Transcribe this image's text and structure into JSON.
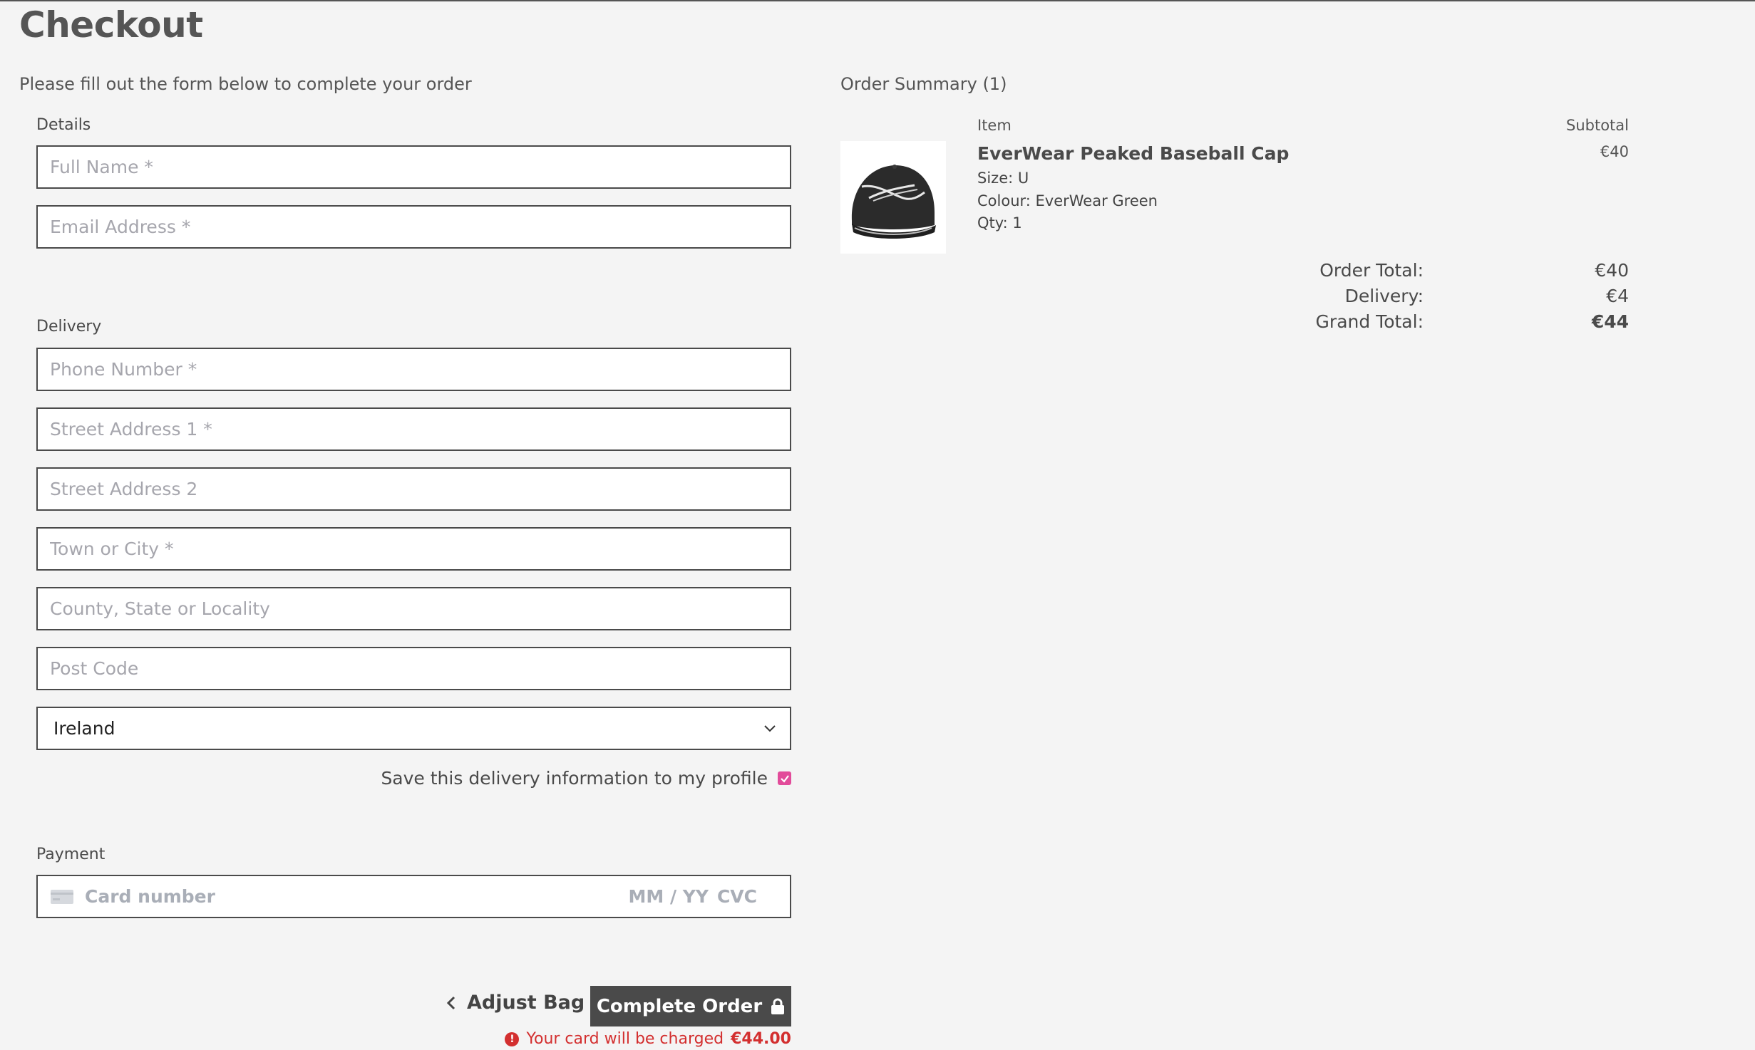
{
  "page": {
    "title": "Checkout",
    "intro": "Please fill out the form below to complete your order"
  },
  "details": {
    "label": "Details",
    "full_name_placeholder": "Full Name *",
    "email_placeholder": "Email Address *"
  },
  "delivery": {
    "label": "Delivery",
    "phone_placeholder": "Phone Number *",
    "street1_placeholder": "Street Address 1 *",
    "street2_placeholder": "Street Address 2",
    "town_placeholder": "Town or City *",
    "county_placeholder": "County, State or Locality",
    "postcode_placeholder": "Post Code",
    "country_selected": "Ireland",
    "save_label": "Save this delivery information to my profile",
    "save_checked": true
  },
  "payment": {
    "label": "Payment",
    "card_number_placeholder": "Card number",
    "expiry_placeholder": "MM / YY",
    "cvc_placeholder": "CVC"
  },
  "actions": {
    "adjust_bag": "Adjust Bag",
    "complete_order": "Complete Order",
    "charge_prefix": "Your card will be charged",
    "charge_amount": "€44.00"
  },
  "summary": {
    "title": "Order Summary (1)",
    "item_header": "Item",
    "subtotal_header": "Subtotal",
    "item": {
      "name": "EverWear Peaked Baseball Cap",
      "size": "Size: U",
      "colour": "Colour: EverWear Green",
      "qty": "Qty: 1",
      "subtotal": "€40"
    },
    "order_total_label": "Order Total:",
    "order_total_value": "€40",
    "delivery_label": "Delivery:",
    "delivery_value": "€4",
    "grand_total_label": "Grand Total:",
    "grand_total_value": "€44"
  },
  "colors": {
    "accent_checkbox": "#e24b9a",
    "error": "#d32f2f",
    "button": "#4a4a4a"
  },
  "icons": [
    "chevron-down-icon",
    "check-icon",
    "card-icon",
    "chevron-left-icon",
    "lock-icon",
    "error-icon"
  ]
}
